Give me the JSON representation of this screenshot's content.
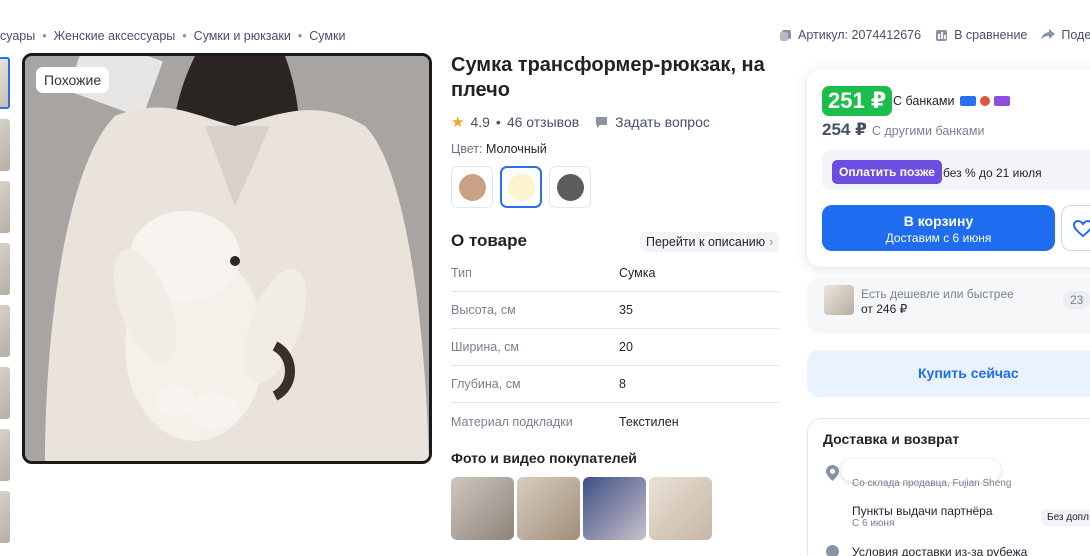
{
  "breadcrumbs": [
    "суары",
    "Женские аксессуары",
    "Сумки и рюкзаки",
    "Сумки"
  ],
  "meta": {
    "article": "Артикул: 2074412676",
    "compare": "В сравнение",
    "share": "Поделит"
  },
  "gallery": {
    "similar_label": "Похожие"
  },
  "product": {
    "title": "Сумка трансформер-рюкзак, на плечо",
    "rating": "4.9",
    "reviews": "46 отзывов",
    "ask_question": "Задать вопрос",
    "color_prefix": "Цвет:",
    "color_value": "Молочный",
    "swatch_colors": [
      "#c9a184",
      "#fbf4cc",
      "#5d5d5d"
    ]
  },
  "about": {
    "title": "О товаре",
    "goto_description": "Перейти к описанию",
    "specs": [
      {
        "key": "Тип",
        "value": "Сумка"
      },
      {
        "key": "Высота, см",
        "value": "35"
      },
      {
        "key": "Ширина, см",
        "value": "20"
      },
      {
        "key": "Глубина, см",
        "value": "8"
      },
      {
        "key": "Материал подкладки",
        "value": "Текстилен"
      }
    ]
  },
  "customer_photos": {
    "title": "Фото и видео покупателей"
  },
  "buybox": {
    "price_bank": "251 ₽",
    "price_bank_label": "С банками",
    "price_other": "254 ₽",
    "price_other_label": "С другими банками",
    "pay_later_button": "Оплатить позже",
    "pay_later_text": "без % до 21 июля",
    "cart_label": "В корзину",
    "cart_sub": "Доставим с 6 июня",
    "cheaper_text": "Есть дешевле или быстрее",
    "cheaper_price": "от 246 ₽",
    "cheaper_count": "23",
    "buy_now": "Купить сейчас"
  },
  "delivery": {
    "title": "Доставка и возврат",
    "from": "Со склада продавца, Fujian Sheng",
    "pickup": "Пункты выдачи партнёра",
    "pickup_date": "С 6 июня",
    "pickup_tag": "Без допл",
    "conditions": "Условия доставки из-за рубежа"
  },
  "colors": {
    "accent": "#1f6cf0",
    "price_green": "#1dbd4c",
    "pay_later": "#6c4fe0"
  }
}
